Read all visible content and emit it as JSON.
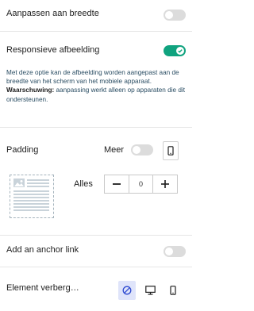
{
  "settings": {
    "fit_width_label": "Aanpassen aan breedte",
    "responsive_label": "Responsieve afbeelding",
    "responsive_desc_1": "Met deze optie kan de afbeelding worden aangepast aan de breedte van het scherm van het mobiele apparaat.",
    "responsive_desc_warning": "Waarschuwing:",
    "responsive_desc_2": "aanpassing werkt alleen op apparaten die dit ondersteunen.",
    "padding_label": "Padding",
    "more_label": "Meer",
    "all_label": "Alles",
    "padding_value": "0",
    "anchor_label": "Add an anchor link",
    "hide_label": "Element verberg…"
  },
  "toggles": {
    "fit_width": false,
    "responsive": true,
    "more": false,
    "anchor": false
  },
  "colors": {
    "accent": "#10a37f",
    "selected_blue": "#2f4bd1",
    "selected_bg": "#dfe4fa"
  },
  "icons": [
    "mobile-icon",
    "image-placeholder-icon",
    "minus-icon",
    "plus-icon",
    "hide-none-icon",
    "desktop-icon",
    "mobile-icon"
  ]
}
